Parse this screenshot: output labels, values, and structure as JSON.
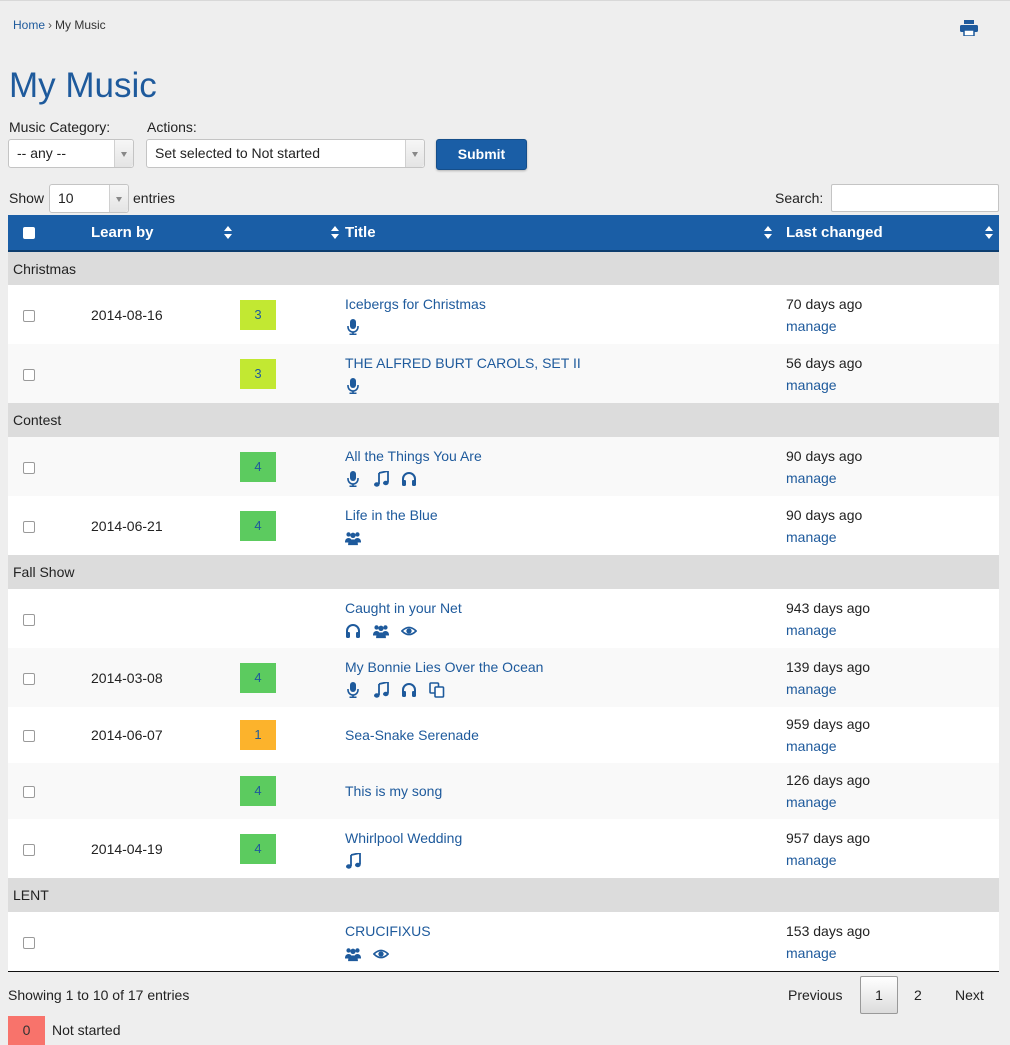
{
  "breadcrumb": {
    "home": "Home",
    "separator": "›",
    "current": "My Music"
  },
  "page_title": "My Music",
  "filters": {
    "category_label": "Music Category:",
    "category_value": "-- any --",
    "actions_label": "Actions:",
    "actions_value": "Set selected to Not started",
    "submit_label": "Submit"
  },
  "length": {
    "show_label": "Show",
    "value": "10",
    "entries_label": "entries"
  },
  "search": {
    "label": "Search:",
    "value": ""
  },
  "columns": {
    "learn_by": "Learn by",
    "title": "Title",
    "last_changed": "Last changed"
  },
  "manage_label": "manage",
  "status_colors": {
    "0": "#f8736b",
    "1": "#fcb32c",
    "3": "#c2e832",
    "4": "#5ccb5f"
  },
  "groups": [
    {
      "name": "Christmas",
      "rows": [
        {
          "learn_by": "2014-08-16",
          "status": "3",
          "title": "Icebergs for Christmas",
          "icons": [
            "microphone-icon"
          ],
          "last_changed": "70 days ago"
        },
        {
          "learn_by": "",
          "status": "3",
          "title": "THE ALFRED BURT CAROLS, SET II",
          "icons": [
            "microphone-icon"
          ],
          "last_changed": "56 days ago"
        }
      ]
    },
    {
      "name": "Contest",
      "rows": [
        {
          "learn_by": "",
          "status": "4",
          "title": "All the Things You Are",
          "icons": [
            "microphone-icon",
            "music-note-icon",
            "headphones-icon"
          ],
          "last_changed": "90 days ago"
        },
        {
          "learn_by": "2014-06-21",
          "status": "4",
          "title": "Life in the Blue",
          "icons": [
            "group-icon"
          ],
          "last_changed": "90 days ago"
        }
      ]
    },
    {
      "name": "Fall Show",
      "rows": [
        {
          "learn_by": "",
          "status": "",
          "title": "Caught in your Net",
          "icons": [
            "headphones-icon",
            "group-icon",
            "eye-icon"
          ],
          "last_changed": "943 days ago"
        },
        {
          "learn_by": "2014-03-08",
          "status": "4",
          "title": "My Bonnie Lies Over the Ocean",
          "icons": [
            "microphone-icon",
            "music-note-icon",
            "headphones-icon",
            "copy-icon"
          ],
          "last_changed": "139 days ago"
        },
        {
          "learn_by": "2014-06-07",
          "status": "1",
          "title": "Sea-Snake Serenade",
          "icons": [],
          "last_changed": "959 days ago"
        },
        {
          "learn_by": "",
          "status": "4",
          "title": "This is my song",
          "icons": [],
          "last_changed": "126 days ago"
        },
        {
          "learn_by": "2014-04-19",
          "status": "4",
          "title": "Whirlpool Wedding",
          "icons": [
            "music-note-icon"
          ],
          "last_changed": "957 days ago"
        }
      ]
    },
    {
      "name": "LENT",
      "rows": [
        {
          "learn_by": "",
          "status": "",
          "title": "CRUCIFIXUS",
          "icons": [
            "group-icon",
            "eye-icon"
          ],
          "last_changed": "153 days ago"
        }
      ]
    }
  ],
  "footer": {
    "info": "Showing 1 to 10 of 17 entries",
    "previous": "Previous",
    "pages": [
      "1",
      "2"
    ],
    "current_page": "1",
    "next": "Next"
  },
  "legend": [
    {
      "value": "0",
      "label": "Not started",
      "color": "#f8736b"
    }
  ]
}
